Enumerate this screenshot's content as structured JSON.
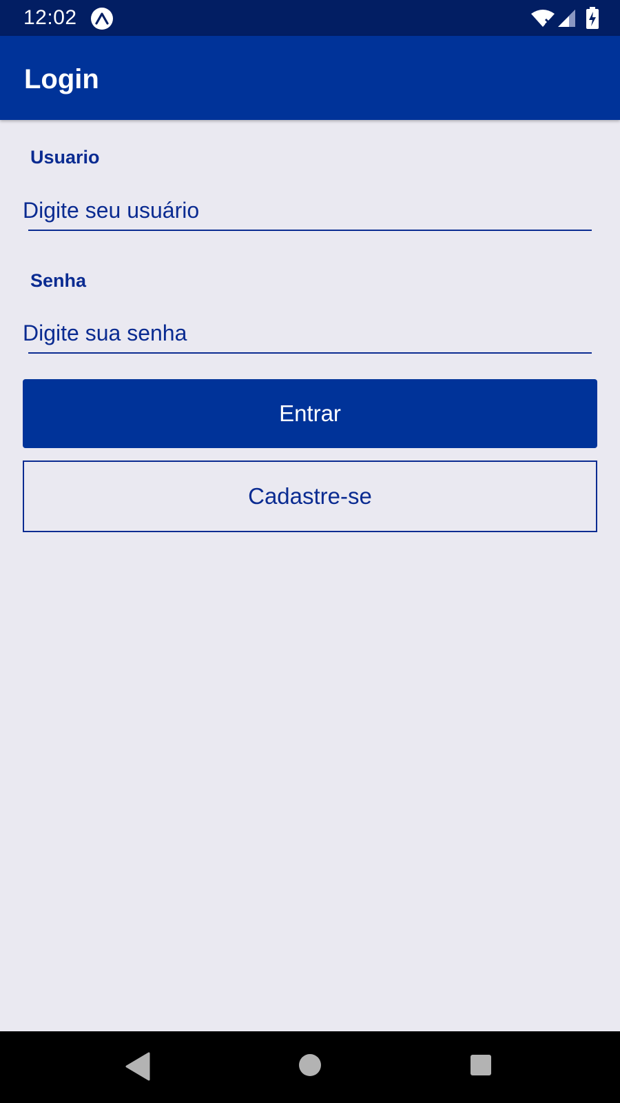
{
  "status_bar": {
    "time": "12:02",
    "icons": [
      "expo-icon",
      "wifi-icon",
      "signal-icon",
      "battery-charging-icon"
    ]
  },
  "app_bar": {
    "title": "Login"
  },
  "form": {
    "username": {
      "label": "Usuario",
      "placeholder": "Digite seu usuário",
      "value": ""
    },
    "password": {
      "label": "Senha",
      "placeholder": "Digite sua senha",
      "value": ""
    }
  },
  "actions": {
    "login_label": "Entrar",
    "signup_label": "Cadastre-se"
  },
  "nav_bar": {
    "icons": [
      "back-icon",
      "home-icon",
      "recent-apps-icon"
    ]
  },
  "colors": {
    "status_bar": "#021e63",
    "primary": "#003399",
    "text_primary": "#0a2b91",
    "background": "#eae9f1",
    "nav_bar": "#000000"
  }
}
